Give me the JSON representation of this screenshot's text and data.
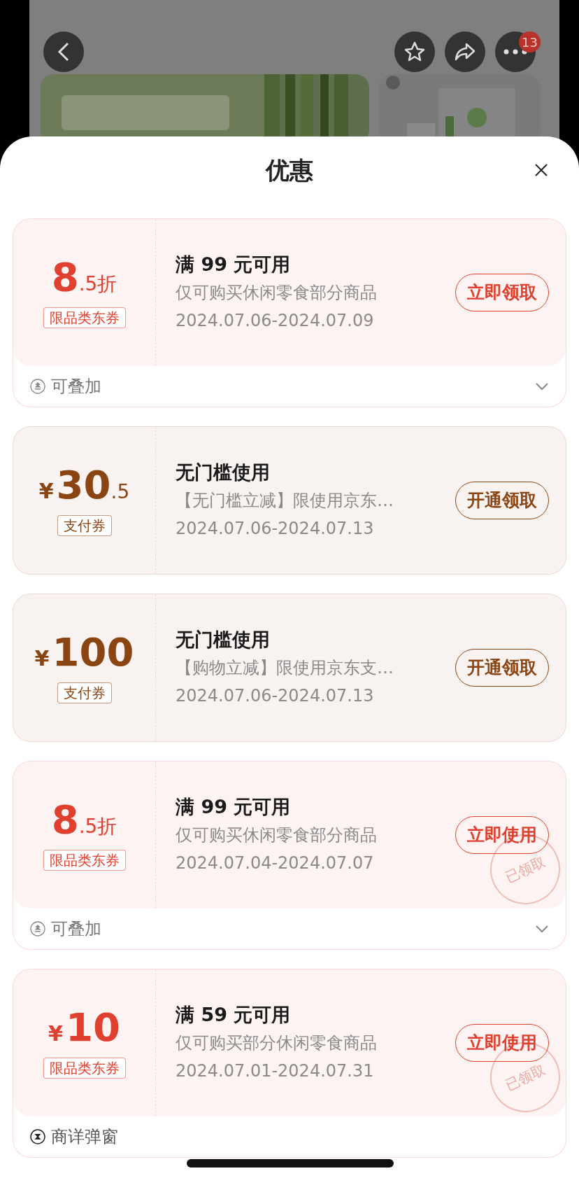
{
  "header": {
    "badge": "13"
  },
  "sheet": {
    "title": "优惠"
  },
  "coupons": [
    {
      "kind": "discount",
      "color": "#e0402f",
      "amount": "8",
      "decimal": ".5",
      "unit": "折",
      "tag": "限品类东券",
      "title": "满 99 元可用",
      "desc": "仅可购买休闲零食部分商品",
      "dates": "2024.07.06-2024.07.09",
      "button": "立即领取",
      "claimed": false,
      "footer": {
        "kind": "stack",
        "text": "可叠加",
        "expandable": true
      }
    },
    {
      "kind": "cash",
      "color": "#8a4513",
      "currency": "¥",
      "amount": "30",
      "decimal": ".5",
      "tag": "支付券",
      "title": "无门槛使用",
      "desc": "【无门槛立减】限使用京东…",
      "dates": "2024.07.06-2024.07.13",
      "button": "开通领取",
      "claimed": false
    },
    {
      "kind": "cash",
      "color": "#8a4513",
      "currency": "¥",
      "amount": "100",
      "tag": "支付券",
      "title": "无门槛使用",
      "desc": "【购物立减】限使用京东支…",
      "dates": "2024.07.06-2024.07.13",
      "button": "开通领取",
      "claimed": false
    },
    {
      "kind": "discount",
      "color": "#e0402f",
      "amount": "8",
      "decimal": ".5",
      "unit": "折",
      "tag": "限品类东券",
      "title": "满 99 元可用",
      "desc": "仅可购买休闲零食部分商品",
      "dates": "2024.07.04-2024.07.07",
      "button": "立即使用",
      "claimed": true,
      "stamp": "已领取",
      "footer": {
        "kind": "stack",
        "text": "可叠加",
        "expandable": true
      }
    },
    {
      "kind": "cash",
      "color": "#e0402f",
      "currency": "¥",
      "amount": "10",
      "tag": "限品类东券",
      "title": "满 59 元可用",
      "desc": "仅可购买部分休闲零食商品",
      "dates": "2024.07.01-2024.07.31",
      "button": "立即使用",
      "claimed": true,
      "stamp": "已领取",
      "footer": {
        "kind": "popup",
        "text": "商详弹窗",
        "expandable": false
      }
    }
  ]
}
